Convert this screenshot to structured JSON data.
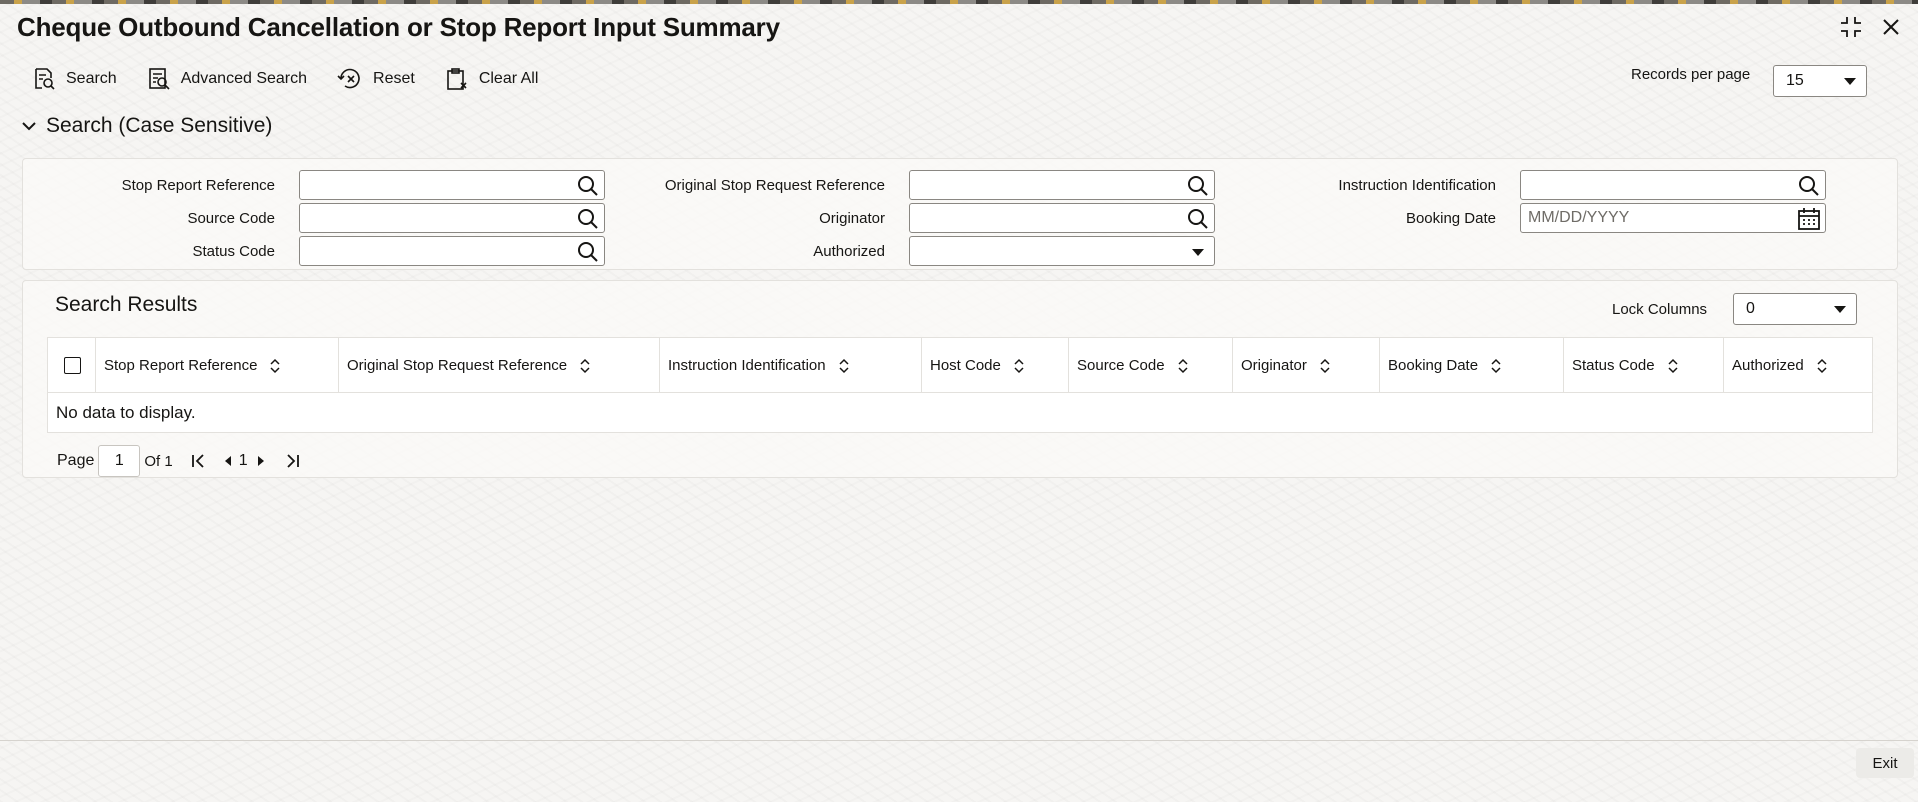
{
  "title": "Cheque Outbound Cancellation or Stop Report Input Summary",
  "icons": {
    "restore": "maximize-icon",
    "close": "close-icon",
    "search": "search-icon",
    "calendar": "calendar-icon",
    "sort": "sort-icon"
  },
  "toolbar": {
    "search_label": "Search",
    "advanced_search_label": "Advanced Search",
    "reset_label": "Reset",
    "clear_all_label": "Clear All"
  },
  "records_per_page": {
    "label": "Records per page",
    "value": "15"
  },
  "search_section": {
    "title": "Search (Case Sensitive)",
    "fields": {
      "stop_report_reference": {
        "label": "Stop Report Reference",
        "value": ""
      },
      "original_stop_request_reference": {
        "label": "Original Stop Request Reference",
        "value": ""
      },
      "instruction_identification": {
        "label": "Instruction Identification",
        "value": ""
      },
      "source_code": {
        "label": "Source Code",
        "value": ""
      },
      "originator": {
        "label": "Originator",
        "value": ""
      },
      "booking_date": {
        "label": "Booking Date",
        "placeholder": "MM/DD/YYYY",
        "value": ""
      },
      "status_code": {
        "label": "Status Code",
        "value": ""
      },
      "authorized": {
        "label": "Authorized",
        "value": ""
      }
    }
  },
  "results": {
    "title": "Search Results",
    "lock_columns": {
      "label": "Lock Columns",
      "value": "0"
    },
    "columns": [
      "Stop Report Reference",
      "Original Stop Request Reference",
      "Instruction Identification",
      "Host Code",
      "Source Code",
      "Originator",
      "Booking Date",
      "Status Code",
      "Authorized"
    ],
    "empty_message": "No data to display.",
    "pager": {
      "page_label": "Page",
      "page_value": "1",
      "of_label": "Of 1",
      "current": "1"
    }
  },
  "footer": {
    "exit_label": "Exit"
  },
  "colors": {
    "text": "#161513",
    "border": "#8a8782",
    "panel": "#faf9f7"
  }
}
